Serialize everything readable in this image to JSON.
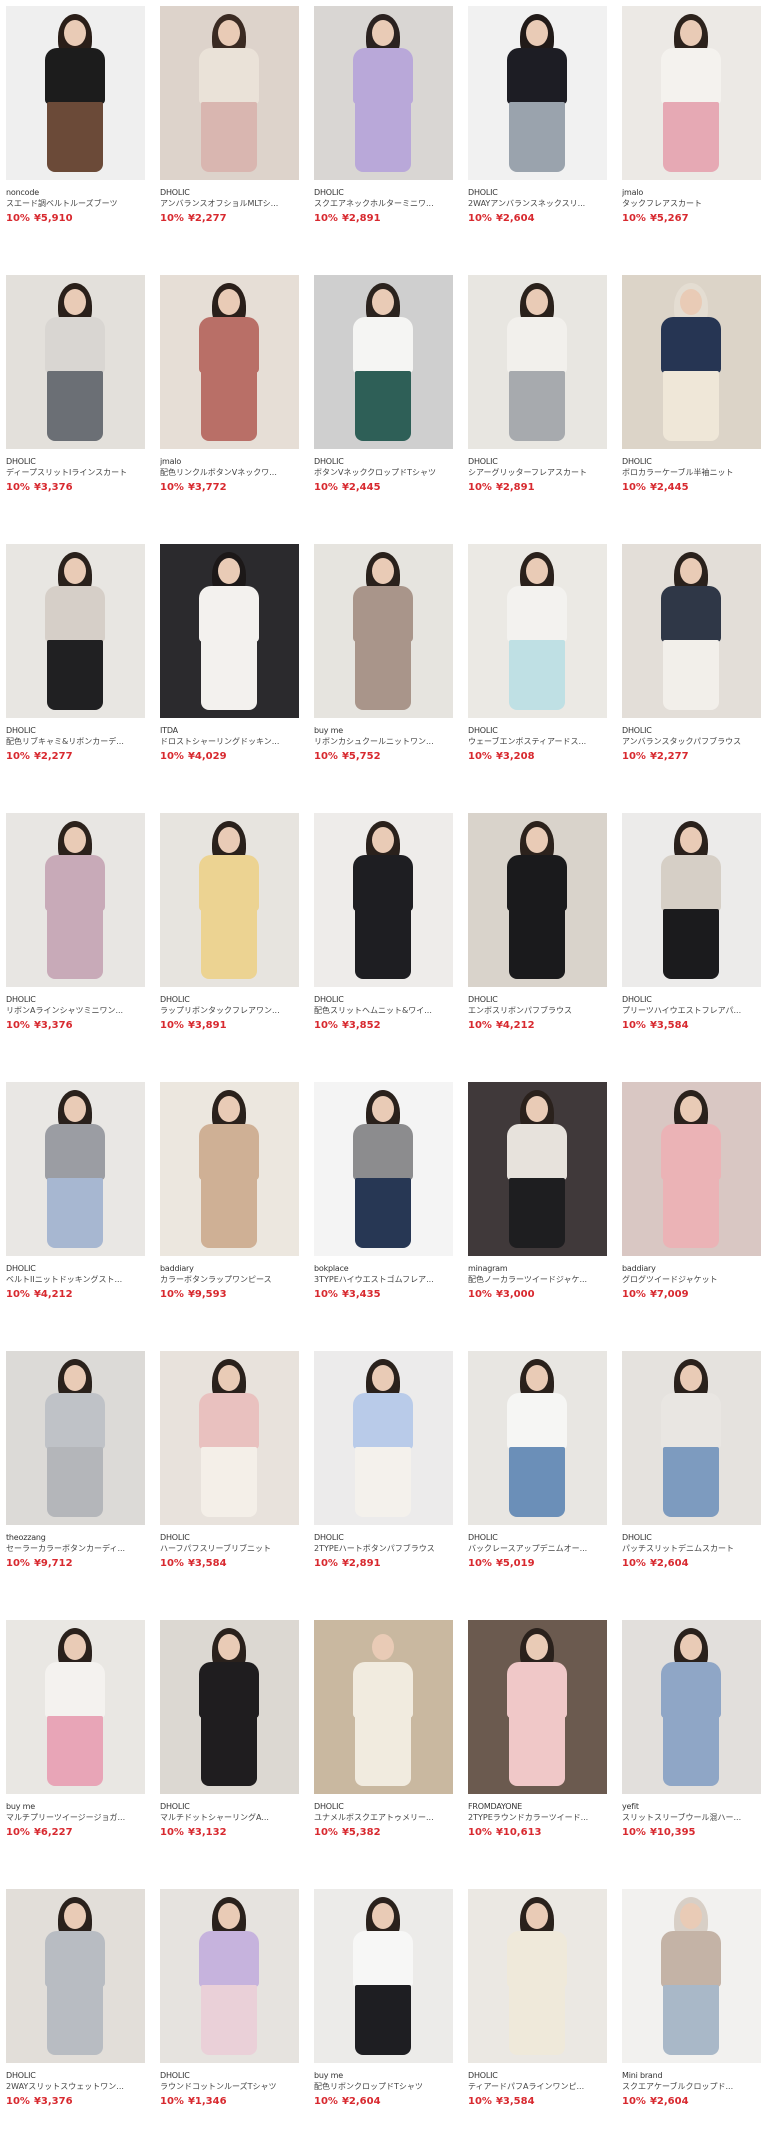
{
  "products": [
    {
      "brand": "noncode",
      "name": "スエード調ベルトルーズブーツ",
      "discount": "10%",
      "price": "¥5,910",
      "colors": {
        "bg": "#efefef",
        "top": "#1c1c1c",
        "bottom": "#6b4a38",
        "hair": "#2a1e18"
      }
    },
    {
      "brand": "DHOLIC",
      "name": "アンバランスオフショルMLTシ...",
      "discount": "10%",
      "price": "¥2,277",
      "colors": {
        "bg": "#ddd3cb",
        "top": "#eae2d8",
        "bottom": "#d9b6b0",
        "hair": "#3a2a22"
      }
    },
    {
      "brand": "DHOLIC",
      "name": "スクエアネックホルターミニワ...",
      "discount": "10%",
      "price": "¥2,891",
      "colors": {
        "bg": "#d9d6d3",
        "top": "#b9a8d9",
        "bottom": "#b9a8d9",
        "hair": "#2b2220"
      }
    },
    {
      "brand": "DHOLIC",
      "name": "2WAYアンバランスネックスリ...",
      "discount": "10%",
      "price": "¥2,604",
      "colors": {
        "bg": "#f1f1f1",
        "top": "#1d1d24",
        "bottom": "#9aa3ad",
        "hair": "#211a18"
      }
    },
    {
      "brand": "jmalo",
      "name": "タックフレアスカート",
      "discount": "10%",
      "price": "¥5,267",
      "colors": {
        "bg": "#ece9e5",
        "top": "#f4f2ee",
        "bottom": "#e6a9b4",
        "hair": "#2c221c"
      }
    },
    {
      "brand": "DHOLIC",
      "name": "ディープスリットIラインスカート",
      "discount": "10%",
      "price": "¥3,376",
      "colors": {
        "bg": "#e3e0db",
        "top": "#d9d6d2",
        "bottom": "#6b6f75",
        "hair": "#2a201a"
      }
    },
    {
      "brand": "jmalo",
      "name": "配色リンクルボタンVネックワ...",
      "discount": "10%",
      "price": "¥3,772",
      "colors": {
        "bg": "#e6ded6",
        "top": "#b96f67",
        "bottom": "#b96f67",
        "hair": "#2a1f1a"
      }
    },
    {
      "brand": "DHOLIC",
      "name": "ボタンVネッククロップドTシャツ",
      "discount": "10%",
      "price": "¥2,445",
      "colors": {
        "bg": "#cfcfcf",
        "top": "#f5f5f3",
        "bottom": "#2e5f57",
        "hair": "#2b231e"
      }
    },
    {
      "brand": "DHOLIC",
      "name": "シアーグリッターフレアスカート",
      "discount": "10%",
      "price": "¥2,891",
      "colors": {
        "bg": "#e8e6e1",
        "top": "#f2f0ec",
        "bottom": "#a7aaae",
        "hair": "#2a211b"
      }
    },
    {
      "brand": "DHOLIC",
      "name": "ボロカラーケーブル半袖ニット",
      "discount": "10%",
      "price": "¥2,445",
      "colors": {
        "bg": "#dcd4c8",
        "top": "#263553",
        "bottom": "#efe7d8",
        "hair": "#e4ddd2"
      }
    },
    {
      "brand": "DHOLIC",
      "name": "配色リブキャミ&リボンカーデ...",
      "discount": "10%",
      "price": "¥2,277",
      "colors": {
        "bg": "#e8e6e2",
        "top": "#d6cfc8",
        "bottom": "#202022",
        "hair": "#2a211c"
      }
    },
    {
      "brand": "ITDA",
      "name": "ドロストシャーリングドッキン...",
      "discount": "10%",
      "price": "¥4,029",
      "colors": {
        "bg": "#2b2a2d",
        "top": "#f3f1ee",
        "bottom": "#f3f1ee",
        "hair": "#1c1818"
      }
    },
    {
      "brand": "buy me",
      "name": "リボンカシュクールニットワン...",
      "discount": "10%",
      "price": "¥5,752",
      "colors": {
        "bg": "#e6e4df",
        "top": "#a9958a",
        "bottom": "#a9958a",
        "hair": "#2a211c"
      }
    },
    {
      "brand": "DHOLIC",
      "name": "ウェーブエンボスティアードス...",
      "discount": "10%",
      "price": "¥3,208",
      "colors": {
        "bg": "#ebe9e4",
        "top": "#f3f2ef",
        "bottom": "#bfe0e4",
        "hair": "#2a211c"
      }
    },
    {
      "brand": "DHOLIC",
      "name": "アンバランスタックパフブラウス",
      "discount": "10%",
      "price": "¥2,277",
      "colors": {
        "bg": "#e3ded8",
        "top": "#2f3747",
        "bottom": "#f2efea",
        "hair": "#2a211c"
      }
    },
    {
      "brand": "DHOLIC",
      "name": "リボンAラインシャツミニワン...",
      "discount": "10%",
      "price": "¥3,376",
      "colors": {
        "bg": "#e8e6e3",
        "top": "#c8aab8",
        "bottom": "#c8aab8",
        "hair": "#2c221c"
      }
    },
    {
      "brand": "DHOLIC",
      "name": "ラップリボンタックフレアワン...",
      "discount": "10%",
      "price": "¥3,891",
      "colors": {
        "bg": "#e7e4df",
        "top": "#ecd392",
        "bottom": "#ecd392",
        "hair": "#2a211c"
      }
    },
    {
      "brand": "DHOLIC",
      "name": "配色スリットヘムニット&ワイ...",
      "discount": "10%",
      "price": "¥3,852",
      "colors": {
        "bg": "#eeecea",
        "top": "#1e1e22",
        "bottom": "#1e1e22",
        "hair": "#2a211c"
      }
    },
    {
      "brand": "DHOLIC",
      "name": "エンボスリボンパフブラウス",
      "discount": "10%",
      "price": "¥4,212",
      "colors": {
        "bg": "#d9d3cb",
        "top": "#1a1a1c",
        "bottom": "#1a1a1c",
        "hair": "#2c221c"
      }
    },
    {
      "brand": "DHOLIC",
      "name": "プリーツハイウエストフレアパ...",
      "discount": "10%",
      "price": "¥3,584",
      "colors": {
        "bg": "#ecebea",
        "top": "#d6cfc6",
        "bottom": "#1b1b1d",
        "hair": "#2a211c"
      }
    },
    {
      "brand": "DHOLIC",
      "name": "ベルトIIニットドッキングスト...",
      "discount": "10%",
      "price": "¥4,212",
      "colors": {
        "bg": "#e9e7e4",
        "top": "#9b9da3",
        "bottom": "#a7b7d1",
        "hair": "#2a211c"
      }
    },
    {
      "brand": "baddiary",
      "name": "カラーボタンラップワンピース",
      "discount": "10%",
      "price": "¥9,593",
      "colors": {
        "bg": "#ece7df",
        "top": "#cfb095",
        "bottom": "#cfb095",
        "hair": "#2a211c"
      }
    },
    {
      "brand": "bokplace",
      "name": "3TYPEハイウエストゴムフレア...",
      "discount": "10%",
      "price": "¥3,435",
      "colors": {
        "bg": "#f4f4f4",
        "top": "#8c8c8e",
        "bottom": "#273754",
        "hair": "#2a211c"
      }
    },
    {
      "brand": "minagram",
      "name": "配色ノーカラーツイードジャケ...",
      "discount": "10%",
      "price": "¥3,000",
      "colors": {
        "bg": "#40393a",
        "top": "#e7e2dc",
        "bottom": "#1e1e20",
        "hair": "#2a211c"
      }
    },
    {
      "brand": "baddiary",
      "name": "グログツイードジャケット",
      "discount": "10%",
      "price": "¥7,009",
      "colors": {
        "bg": "#d9c7c3",
        "top": "#ebb3b6",
        "bottom": "#ebb3b6",
        "hair": "#2a211c"
      }
    },
    {
      "brand": "theozzang",
      "name": "セーラーカラーボタンカーディ...",
      "discount": "10%",
      "price": "¥9,712",
      "colors": {
        "bg": "#dcdad7",
        "top": "#bfc2c7",
        "bottom": "#b4b6ba",
        "hair": "#2a211c"
      }
    },
    {
      "brand": "DHOLIC",
      "name": "ハーフパフスリーブリブニット",
      "discount": "10%",
      "price": "¥3,584",
      "colors": {
        "bg": "#e8e2dc",
        "top": "#e9c1bf",
        "bottom": "#f4efe8",
        "hair": "#2a211c"
      }
    },
    {
      "brand": "DHOLIC",
      "name": "2TYPEハートボタンパフブラウス",
      "discount": "10%",
      "price": "¥2,891",
      "colors": {
        "bg": "#ecebeb",
        "top": "#b9cbe9",
        "bottom": "#f4f1ec",
        "hair": "#2a211c"
      }
    },
    {
      "brand": "DHOLIC",
      "name": "バックレースアップデニムオー...",
      "discount": "10%",
      "price": "¥5,019",
      "colors": {
        "bg": "#e8e6e2",
        "top": "#f6f6f4",
        "bottom": "#6b8fb8",
        "hair": "#2a211c"
      }
    },
    {
      "brand": "DHOLIC",
      "name": "パッチスリットデニムスカート",
      "discount": "10%",
      "price": "¥2,604",
      "colors": {
        "bg": "#e5e2de",
        "top": "#e9e6e2",
        "bottom": "#7d9bbf",
        "hair": "#2a211c"
      }
    },
    {
      "brand": "buy me",
      "name": "マルチプリーツイージージョガ...",
      "discount": "10%",
      "price": "¥6,227",
      "colors": {
        "bg": "#e9e7e3",
        "top": "#f4f2ef",
        "bottom": "#e8a5b7",
        "hair": "#2a211c"
      }
    },
    {
      "brand": "DHOLIC",
      "name": "マルチドットシャーリングA...",
      "discount": "10%",
      "price": "¥3,132",
      "colors": {
        "bg": "#dcd8d2",
        "top": "#1f1d1f",
        "bottom": "#1f1d1f",
        "hair": "#2a211c"
      }
    },
    {
      "brand": "DHOLIC",
      "name": "ユナメルボスクエアトゥメリー...",
      "discount": "10%",
      "price": "¥5,382",
      "colors": {
        "bg": "#c9b8a0",
        "top": "#f1ebdf",
        "bottom": "#f1ebdf",
        "hair": "#c9b8a0"
      }
    },
    {
      "brand": "FROMDAYONE",
      "name": "2TYPEラウンドカラーツイード...",
      "discount": "10%",
      "price": "¥10,613",
      "colors": {
        "bg": "#6b5a4f",
        "top": "#f0c8c8",
        "bottom": "#f0c8c8",
        "hair": "#2a211c"
      }
    },
    {
      "brand": "yefit",
      "name": "スリットスリーブウール混ハー...",
      "discount": "10%",
      "price": "¥10,395",
      "colors": {
        "bg": "#e2dfdc",
        "top": "#8fa6c6",
        "bottom": "#8fa6c6",
        "hair": "#2a211c"
      }
    },
    {
      "brand": "DHOLIC",
      "name": "2WAYスリットスウェットワン...",
      "discount": "10%",
      "price": "¥3,376",
      "colors": {
        "bg": "#e2ded9",
        "top": "#b8bcc2",
        "bottom": "#b8bcc2",
        "hair": "#2a211c"
      }
    },
    {
      "brand": "DHOLIC",
      "name": "ラウンドコットンルーズTシャツ",
      "discount": "10%",
      "price": "¥1,346",
      "colors": {
        "bg": "#e6e3df",
        "top": "#c6b3dd",
        "bottom": "#ead0d8",
        "hair": "#2a211c"
      }
    },
    {
      "brand": "buy me",
      "name": "配色リボンクロップドTシャツ",
      "discount": "10%",
      "price": "¥2,604",
      "colors": {
        "bg": "#ecebe9",
        "top": "#f7f7f6",
        "bottom": "#1e1e22",
        "hair": "#2a211c"
      }
    },
    {
      "brand": "DHOLIC",
      "name": "ティアードパフAラインワンピ...",
      "discount": "10%",
      "price": "¥3,584",
      "colors": {
        "bg": "#ebe8e3",
        "top": "#efe9da",
        "bottom": "#efe9da",
        "hair": "#2a211c"
      }
    },
    {
      "brand": "Mini brand",
      "name": "スクエアケーブルクロップド...",
      "discount": "10%",
      "price": "¥2,604",
      "colors": {
        "bg": "#f2f1ef",
        "top": "#c4b3a6",
        "bottom": "#a9b8c8",
        "hair": "#d8cfc6"
      }
    }
  ]
}
